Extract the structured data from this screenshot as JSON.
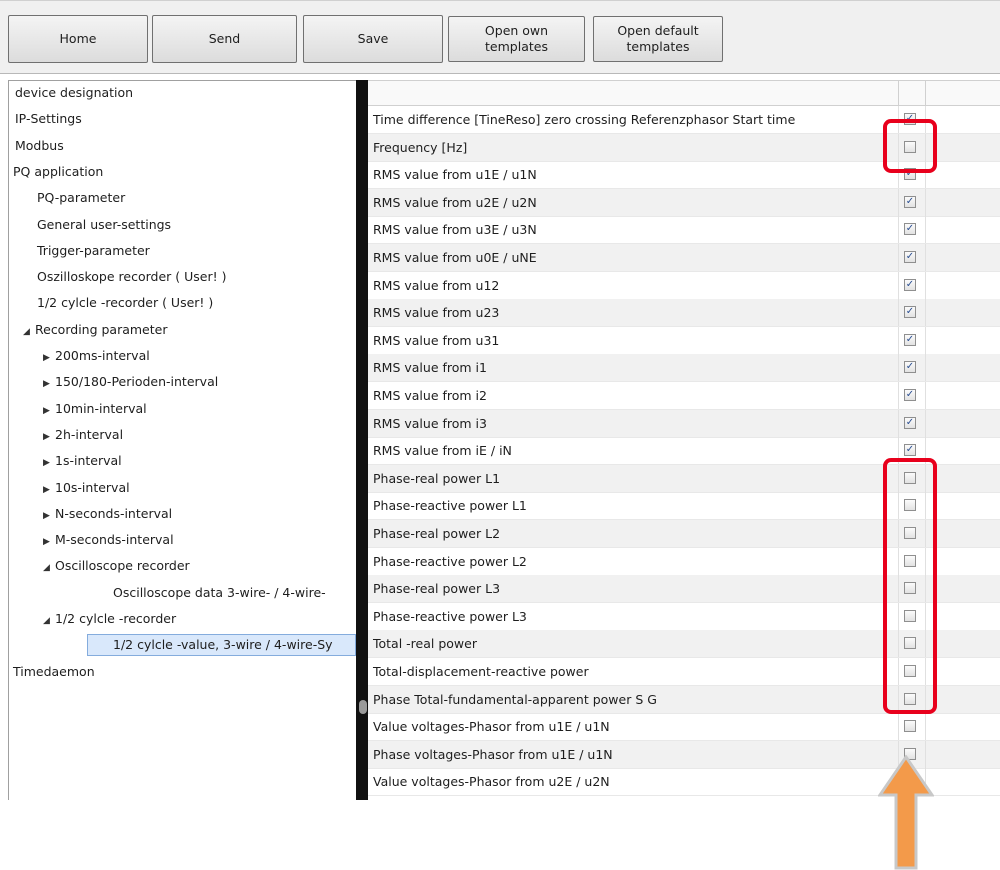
{
  "toolbar": {
    "home": "Home",
    "send": "Send",
    "save": "Save",
    "open_own_1": "Open own",
    "open_own_2": "templates",
    "open_default_1": "Open default",
    "open_default_2": "templates"
  },
  "tree": [
    {
      "label": "device designation",
      "level": 0,
      "arrow": ""
    },
    {
      "label": "IP-Settings",
      "level": 0,
      "arrow": ""
    },
    {
      "label": "Modbus",
      "level": 0,
      "arrow": ""
    },
    {
      "label": "PQ application",
      "level": 0,
      "arrow": "expanded"
    },
    {
      "label": "PQ-parameter",
      "level": 1,
      "arrow": ""
    },
    {
      "label": "General user-settings",
      "level": 1,
      "arrow": ""
    },
    {
      "label": "Trigger-parameter",
      "level": 1,
      "arrow": ""
    },
    {
      "label": "Oszilloskope recorder ( User! )",
      "level": 1,
      "arrow": ""
    },
    {
      "label": "1/2 cylcle -recorder ( User! )",
      "level": 1,
      "arrow": ""
    },
    {
      "label": "Recording parameter",
      "level": 1,
      "arrow": "expanded"
    },
    {
      "label": "200ms-interval",
      "level": 2,
      "arrow": "collapsed"
    },
    {
      "label": "150/180-Perioden-interval",
      "level": 2,
      "arrow": "collapsed"
    },
    {
      "label": "10min-interval",
      "level": 2,
      "arrow": "collapsed"
    },
    {
      "label": "2h-interval",
      "level": 2,
      "arrow": "collapsed"
    },
    {
      "label": "1s-interval",
      "level": 2,
      "arrow": "collapsed"
    },
    {
      "label": "10s-interval",
      "level": 2,
      "arrow": "collapsed"
    },
    {
      "label": "N-seconds-interval",
      "level": 2,
      "arrow": "collapsed"
    },
    {
      "label": "M-seconds-interval",
      "level": 2,
      "arrow": "collapsed"
    },
    {
      "label": "Oscilloscope recorder",
      "level": 2,
      "arrow": "expanded"
    },
    {
      "label": "Oscilloscope data 3-wire- / 4-wire-",
      "level": 3,
      "arrow": ""
    },
    {
      "label": "1/2 cylcle -recorder",
      "level": 2,
      "arrow": "expanded"
    },
    {
      "label": "1/2 cylcle -value, 3-wire / 4-wire-Sy",
      "level": 3,
      "arrow": "",
      "selected": true
    },
    {
      "label": "Timedaemon",
      "level": 0,
      "arrow": "collapsed"
    }
  ],
  "rows": [
    {
      "label": "Time difference [TineReso] zero crossing Referenzphasor Start time",
      "checked": true
    },
    {
      "label": "Frequency [Hz]",
      "checked": false
    },
    {
      "label": "RMS value from u1E / u1N",
      "checked": true
    },
    {
      "label": "RMS value from u2E / u2N",
      "checked": true
    },
    {
      "label": "RMS value from u3E / u3N",
      "checked": true
    },
    {
      "label": "RMS value from u0E / uNE",
      "checked": true
    },
    {
      "label": "RMS value from u12",
      "checked": true
    },
    {
      "label": "RMS value from u23",
      "checked": true
    },
    {
      "label": "RMS value from u31",
      "checked": true
    },
    {
      "label": "RMS value from i1",
      "checked": true
    },
    {
      "label": "RMS value from i2",
      "checked": true
    },
    {
      "label": "RMS value from i3",
      "checked": true
    },
    {
      "label": "RMS value from iE / iN",
      "checked": true
    },
    {
      "label": "Phase-real power L1",
      "checked": false
    },
    {
      "label": "Phase-reactive power L1",
      "checked": false
    },
    {
      "label": "Phase-real power L2",
      "checked": false
    },
    {
      "label": "Phase-reactive power L2",
      "checked": false
    },
    {
      "label": "Phase-real power L3",
      "checked": false
    },
    {
      "label": "Phase-reactive power L3",
      "checked": false
    },
    {
      "label": "Total -real power",
      "checked": false
    },
    {
      "label": "Total-displacement-reactive power",
      "checked": false
    },
    {
      "label": "Phase Total-fundamental-apparent power S G",
      "checked": false
    },
    {
      "label": "Value voltages-Phasor from u1E / u1N",
      "checked": false
    },
    {
      "label": "Phase voltages-Phasor from u1E / u1N",
      "checked": false
    },
    {
      "label": "Value voltages-Phasor from u2E / u2N",
      "checked": false
    }
  ],
  "colors": {
    "highlight": "#e8001c",
    "arrow_fill": "#f39a4a",
    "arrow_stroke": "#c8c8c8",
    "selection": "#d9e8fb"
  },
  "icons": {
    "expanded": "triangle-down-icon",
    "collapsed": "triangle-right-icon",
    "check": "checkmark-icon",
    "annotation_arrow": "up-arrow-icon"
  }
}
